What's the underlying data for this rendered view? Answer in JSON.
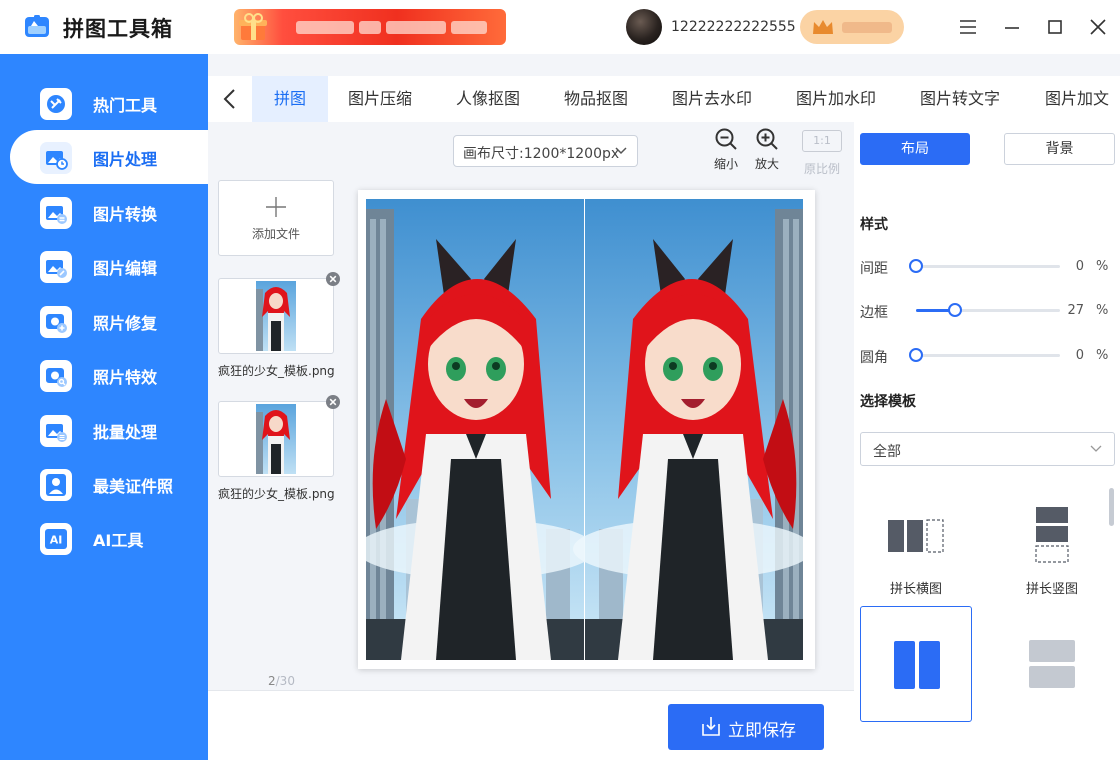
{
  "app": {
    "title": "拼图工具箱",
    "user_id": "12222222222555"
  },
  "sidebar": {
    "items": [
      {
        "label": "热门工具",
        "icon": "hot-tools-icon"
      },
      {
        "label": "图片处理",
        "icon": "image-process-icon",
        "active": true
      },
      {
        "label": "图片转换",
        "icon": "image-convert-icon"
      },
      {
        "label": "图片编辑",
        "icon": "image-edit-icon"
      },
      {
        "label": "照片修复",
        "icon": "photo-repair-icon"
      },
      {
        "label": "照片特效",
        "icon": "photo-effects-icon"
      },
      {
        "label": "批量处理",
        "icon": "batch-process-icon"
      },
      {
        "label": "最美证件照",
        "icon": "id-photo-icon"
      },
      {
        "label": "AI工具",
        "icon": "ai-tools-icon"
      }
    ]
  },
  "tabs": [
    "拼图",
    "图片压缩",
    "人像抠图",
    "物品抠图",
    "图片去水印",
    "图片加水印",
    "图片转文字",
    "图片加文"
  ],
  "toolbar": {
    "canvas_size": "画布尺寸:1200*1200px",
    "zoom_out": "缩小",
    "zoom_in": "放大",
    "ratio_label": "1:1",
    "original": "原比例"
  },
  "files": {
    "add_label": "添加文件",
    "items": [
      "疯狂的少女_模板.png",
      "疯狂的少女_模板.png"
    ],
    "pager_current": "2",
    "pager_total": "/30"
  },
  "save_label": "立即保存",
  "panel": {
    "layout_btn": "布局",
    "background_btn": "背景",
    "style_title": "样式",
    "sliders": [
      {
        "label": "间距",
        "value": 0,
        "unit": "%"
      },
      {
        "label": "边框",
        "value": 27,
        "unit": "%"
      },
      {
        "label": "圆角",
        "value": 0,
        "unit": "%"
      }
    ],
    "template_title": "选择模板",
    "template_filter": "全部",
    "templates": [
      {
        "label": "拼长横图"
      },
      {
        "label": "拼长竖图"
      },
      {
        "label": ""
      },
      {
        "label": ""
      }
    ]
  },
  "colors": {
    "accent": "#2b6cf5",
    "sidebar": "#2e86ff",
    "hair": "#e0141b"
  }
}
